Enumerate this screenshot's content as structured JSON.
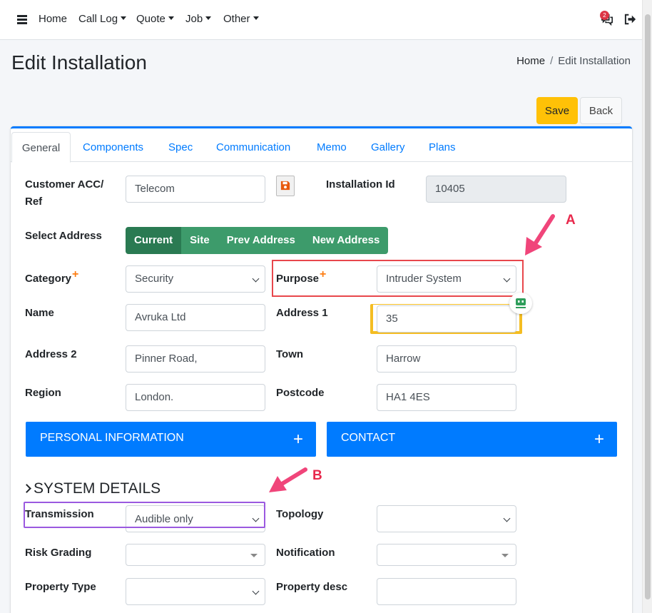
{
  "navbar": {
    "items": [
      {
        "label": "Home",
        "dropdown": false
      },
      {
        "label": "Call Log",
        "dropdown": true
      },
      {
        "label": "Quote",
        "dropdown": true
      },
      {
        "label": "Job",
        "dropdown": true
      },
      {
        "label": "Other",
        "dropdown": true
      }
    ],
    "notification_count": "2"
  },
  "header": {
    "title": "Edit Installation",
    "breadcrumb": [
      "Home",
      "Edit Installation"
    ]
  },
  "actions": {
    "save_label": "Save",
    "back_label": "Back"
  },
  "tabs": [
    "General",
    "Components",
    "Spec",
    "Communication",
    "Memo",
    "Gallery",
    "Plans"
  ],
  "active_tab": "General",
  "form": {
    "customer_ref": {
      "label_line1": "Customer ACC/",
      "label_line2": "Ref",
      "value": "Telecom"
    },
    "installation_id": {
      "label": "Installation Id",
      "value": "10405"
    },
    "select_address": {
      "label": "Select Address",
      "options": [
        "Current",
        "Site",
        "Prev Address",
        "New Address"
      ],
      "active": "Current"
    },
    "category": {
      "label": "Category",
      "value": "Security",
      "required_mark": "+"
    },
    "purpose": {
      "label": "Purpose",
      "value": "Intruder System",
      "required_mark": "+"
    },
    "name": {
      "label": "Name",
      "value": "Avruka Ltd"
    },
    "address1": {
      "label": "Address 1",
      "value": "35"
    },
    "address2": {
      "label": "Address 2",
      "value": "Pinner Road,"
    },
    "town": {
      "label": "Town",
      "value": "Harrow"
    },
    "region": {
      "label": "Region",
      "value": "London."
    },
    "postcode": {
      "label": "Postcode",
      "value": "HA1 4ES"
    }
  },
  "sections": {
    "personal_information": {
      "label": "PERSONAL INFORMATION",
      "toggle": "+"
    },
    "contact": {
      "label": "CONTACT",
      "toggle": "+"
    },
    "system_details": "SYSTEM DETAILS"
  },
  "system": {
    "transmission": {
      "label": "Transmission",
      "value": "Audible only"
    },
    "topology": {
      "label": "Topology",
      "value": ""
    },
    "risk_grading": {
      "label": "Risk Grading",
      "value": ""
    },
    "notification": {
      "label": "Notification",
      "value": ""
    },
    "property_type": {
      "label": "Property Type",
      "value": ""
    },
    "property_desc": {
      "label": "Property desc",
      "value": ""
    }
  },
  "annotations": {
    "a": "A",
    "b": "B"
  },
  "colors": {
    "primary": "#007bff",
    "save": "#ffc107",
    "address_btn": "#3d9b6b",
    "address_active": "#2a7a52",
    "annotation": "#e8294c",
    "highlight_red": "#e8474c",
    "highlight_purple": "#9b59e0"
  },
  "icons": [
    "hamburger-icon",
    "chat-icon",
    "logout-icon",
    "floppy-disk-icon",
    "chevron-down-icon",
    "chevron-right-icon",
    "plus-icon",
    "bot-icon",
    "arrow-icon"
  ]
}
